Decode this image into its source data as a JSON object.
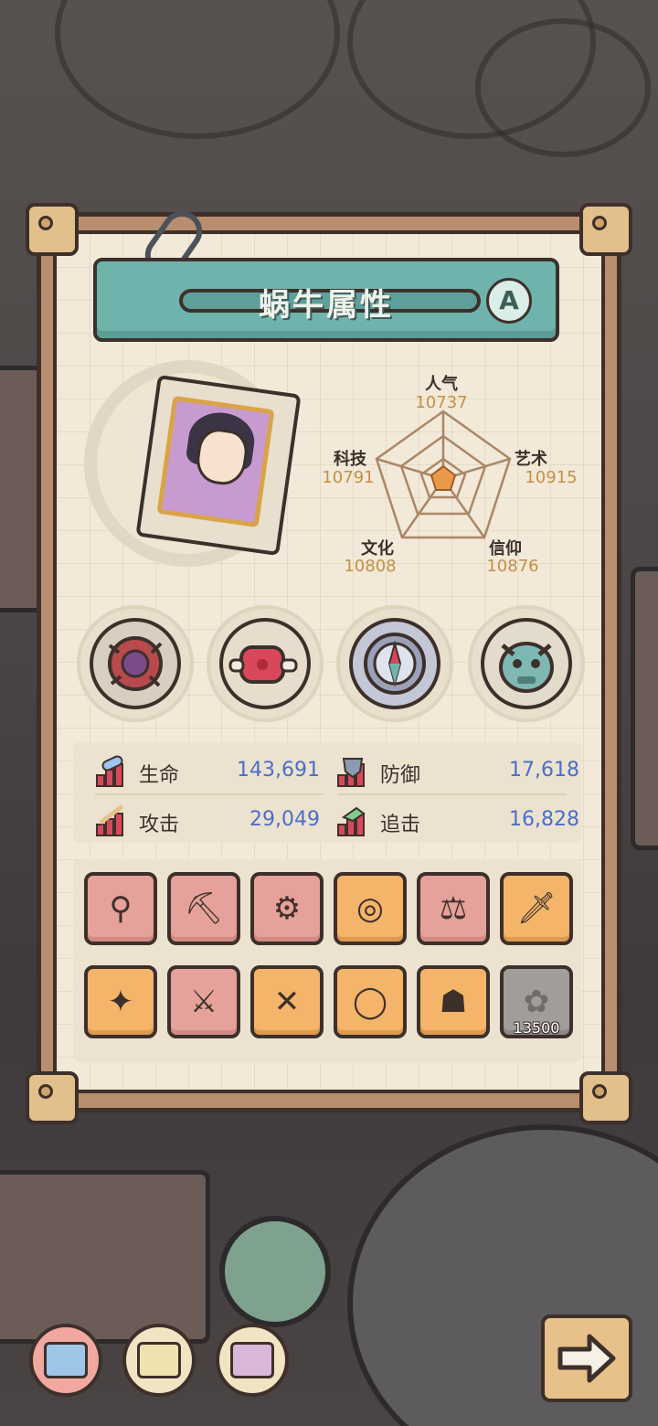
{
  "panel": {
    "title": "蜗牛属性",
    "grade": "A"
  },
  "radar": {
    "popularity": {
      "label": "人气",
      "value": "10737"
    },
    "art": {
      "label": "艺术",
      "value": "10915"
    },
    "faith": {
      "label": "信仰",
      "value": "10876"
    },
    "culture": {
      "label": "文化",
      "value": "10808"
    },
    "tech": {
      "label": "科技",
      "value": "10791"
    }
  },
  "skills": [
    "thorn-orb-icon",
    "meat-orb-icon",
    "compass-orb-icon",
    "dragon-orb-icon"
  ],
  "stats": {
    "hp": {
      "label": "生命",
      "value": "143,691"
    },
    "defense": {
      "label": "防御",
      "value": "17,618"
    },
    "attack": {
      "label": "攻击",
      "value": "29,049"
    },
    "pursuit": {
      "label": "追击",
      "value": "16,828"
    }
  },
  "equipment": [
    {
      "icon": "mace-icon",
      "rarity": "red"
    },
    {
      "icon": "pickaxe-icon",
      "rarity": "red"
    },
    {
      "icon": "blaster-icon",
      "rarity": "red"
    },
    {
      "icon": "goggles-icon",
      "rarity": "orange"
    },
    {
      "icon": "scale-icon",
      "rarity": "red"
    },
    {
      "icon": "dagger-icon",
      "rarity": "orange"
    },
    {
      "icon": "rocket-icon",
      "rarity": "orange"
    },
    {
      "icon": "sword-icon",
      "rarity": "red"
    },
    {
      "icon": "crossed-blades-icon",
      "rarity": "orange"
    },
    {
      "icon": "ring-icon",
      "rarity": "orange"
    },
    {
      "icon": "mummy-icon",
      "rarity": "orange"
    },
    {
      "icon": "rose-locked-icon",
      "rarity": "gray",
      "cost": "13500"
    }
  ],
  "colors": {
    "paper": "#f2e9d8",
    "banner": "#6fb3ad",
    "statValue": "#4a6fc7",
    "radarValue": "#c48f47",
    "slotRed": "#e5a19a",
    "slotOrange": "#f4b46a"
  }
}
